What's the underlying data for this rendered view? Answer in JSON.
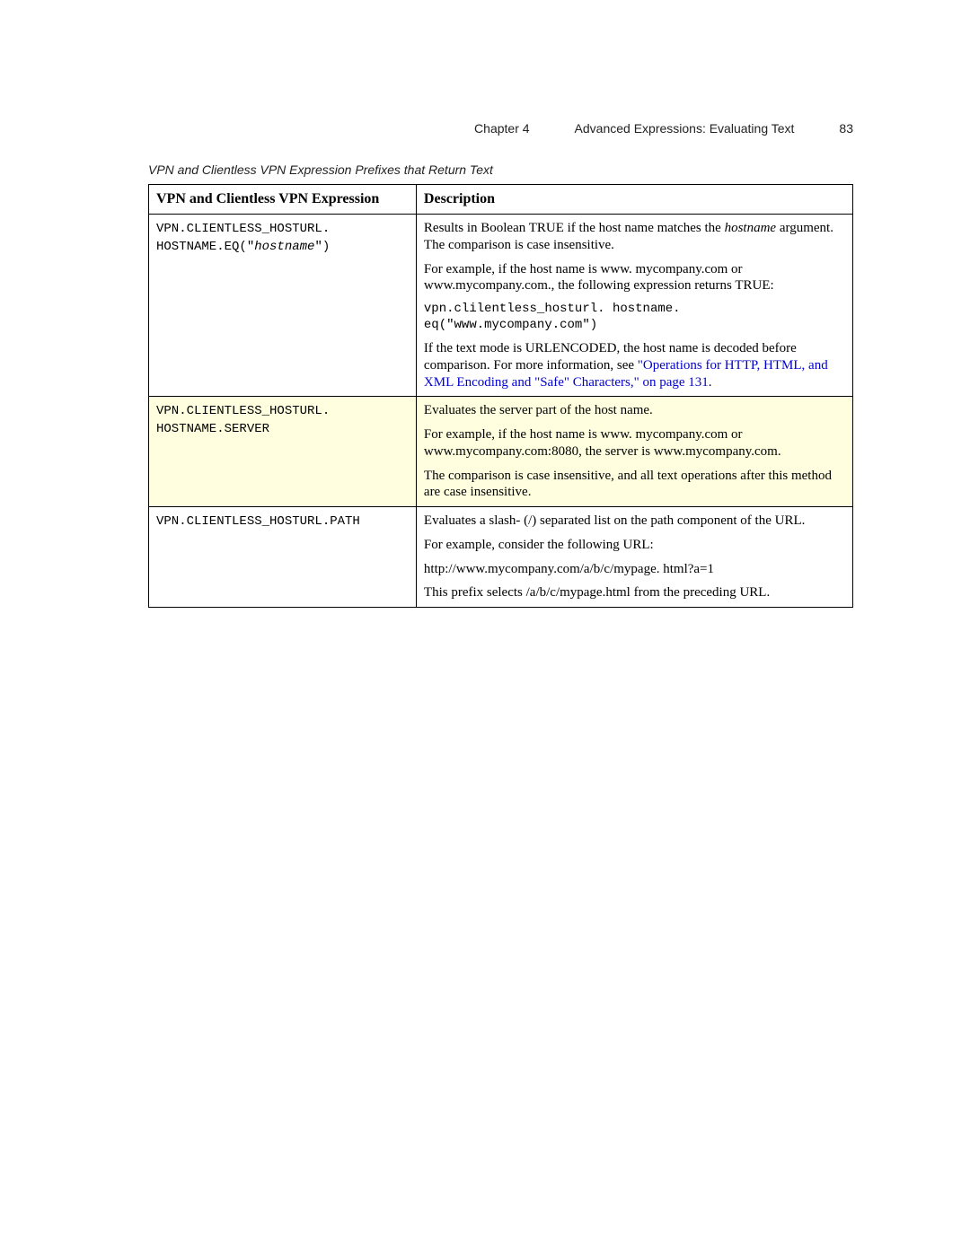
{
  "header": {
    "chapter": "Chapter 4",
    "title": "Advanced Expressions: Evaluating Text",
    "pagenum": "83"
  },
  "caption": "VPN and Clientless VPN Expression Prefixes that Return Text",
  "columns": {
    "col1": "VPN and Clientless VPN Expression",
    "col2": "Description"
  },
  "rows": {
    "r1": {
      "expr_pre": "VPN.CLIENTLESS_HOSTURL.",
      "expr_line2_pre": "HOSTNAME.EQ(\"",
      "expr_arg": "hostname",
      "expr_line2_post": "\")",
      "d1a": "Results in Boolean TRUE if the host name matches the ",
      "d1_arg": "hostname",
      "d1b": " argument. The comparison is case insensitive.",
      "d2": "For example, if the host name is www. mycompany.com or www.mycompany.com., the following expression returns TRUE:",
      "d3": "vpn.clilentless_hosturl. hostname. eq(\"www.mycompany.com\")",
      "d4a": "If the text mode is URLENCODED, the host name is decoded before comparison. For more information, see ",
      "d4_link": "\"Operations for HTTP, HTML, and XML Encoding and \"Safe\" Characters,\" on page 131",
      "d4b": "."
    },
    "r2": {
      "expr": "VPN.CLIENTLESS_HOSTURL. HOSTNAME.SERVER",
      "d1": "Evaluates the server part of the host name.",
      "d2": "For example, if the host name is www. mycompany.com or www.mycompany.com:8080, the server is www.mycompany.com.",
      "d3": "The comparison is case insensitive, and all text operations after this method are case insensitive."
    },
    "r3": {
      "expr": "VPN.CLIENTLESS_HOSTURL.PATH",
      "d1": "Evaluates a slash- (/) separated list on the path component of the URL.",
      "d2": "For example, consider the following URL:",
      "d3": "http://www.mycompany.com/a/b/c/mypage. html?a=1",
      "d4": "This prefix selects /a/b/c/mypage.html from the preceding URL."
    }
  }
}
